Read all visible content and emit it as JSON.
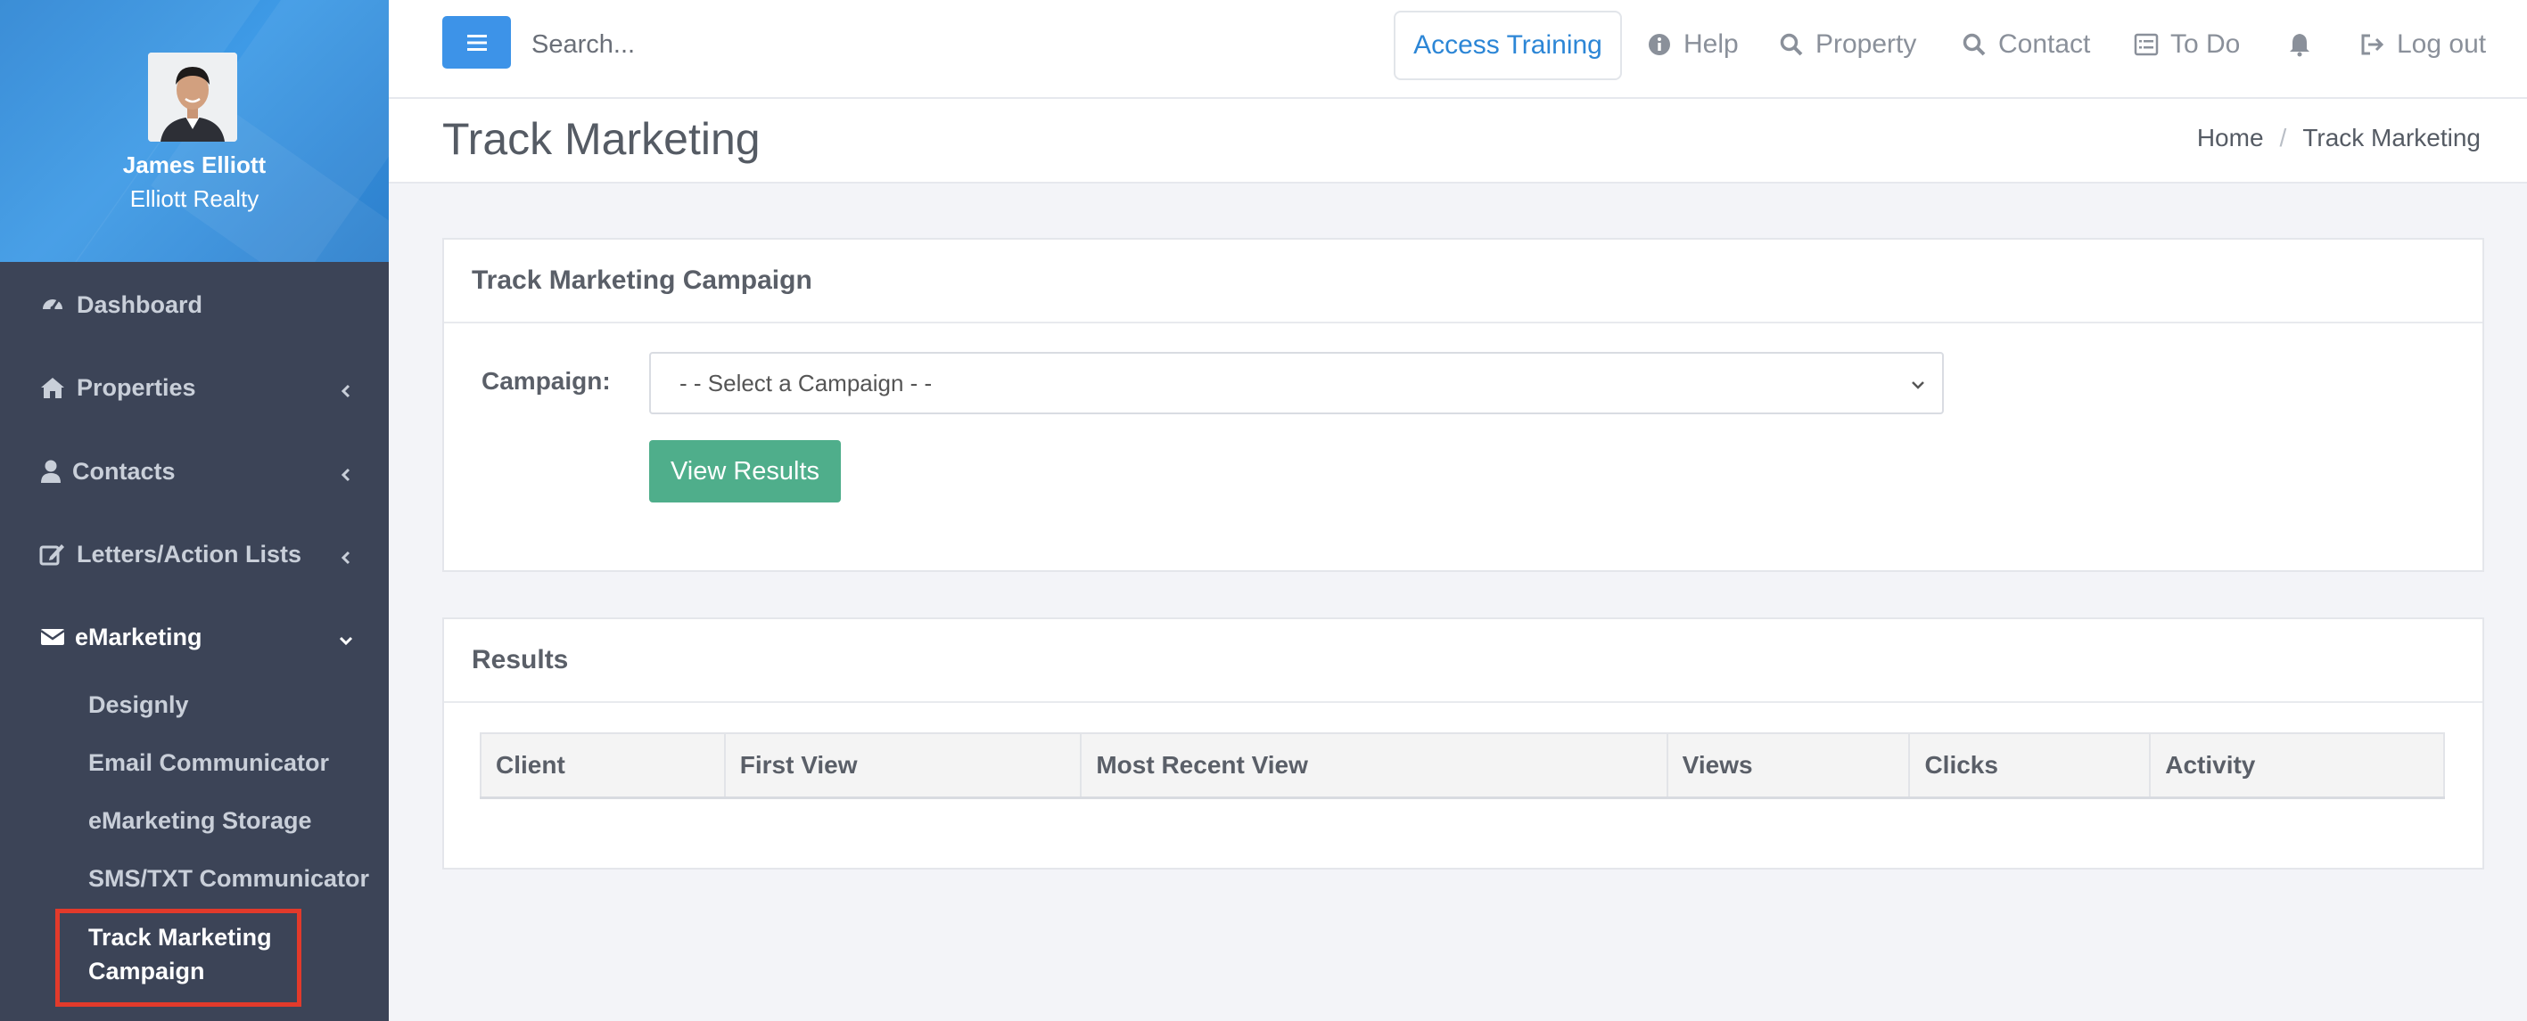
{
  "profile": {
    "name": "James Elliott",
    "company": "Elliott Realty"
  },
  "sidebar": {
    "items": [
      {
        "label": "Dashboard",
        "icon": "dashboard-icon"
      },
      {
        "label": "Properties",
        "icon": "home-icon"
      },
      {
        "label": "Contacts",
        "icon": "user-icon"
      },
      {
        "label": "Letters/Action Lists",
        "icon": "edit-icon"
      },
      {
        "label": "eMarketing",
        "icon": "envelope-icon"
      }
    ],
    "emarketing_subitems": [
      "Designly",
      "Email Communicator",
      "eMarketing Storage",
      "SMS/TXT Communicator"
    ],
    "current_subitem_line1": "Track Marketing",
    "current_subitem_line2": "Campaign"
  },
  "topbar": {
    "search_placeholder": "Search...",
    "access_training": "Access Training",
    "help": "Help",
    "property": "Property",
    "contact": "Contact",
    "todo": "To Do",
    "logout": "Log out"
  },
  "page": {
    "title": "Track Marketing",
    "breadcrumb": {
      "home": "Home",
      "separator": "/",
      "current": "Track Marketing"
    }
  },
  "campaign_panel": {
    "heading": "Track Marketing Campaign",
    "field_label": "Campaign:",
    "select_value": "- - Select a Campaign - -",
    "button_label": "View Results"
  },
  "results_panel": {
    "heading": "Results",
    "columns": [
      "Client",
      "First View",
      "Most Recent View",
      "Views",
      "Clicks",
      "Activity"
    ]
  },
  "colors": {
    "sidebar_bg": "#3c4457",
    "profile_blue": "#2f87d4",
    "accent_blue": "#3d93e8",
    "button_green": "#4fae8b",
    "highlight_red": "#e23a2b"
  }
}
